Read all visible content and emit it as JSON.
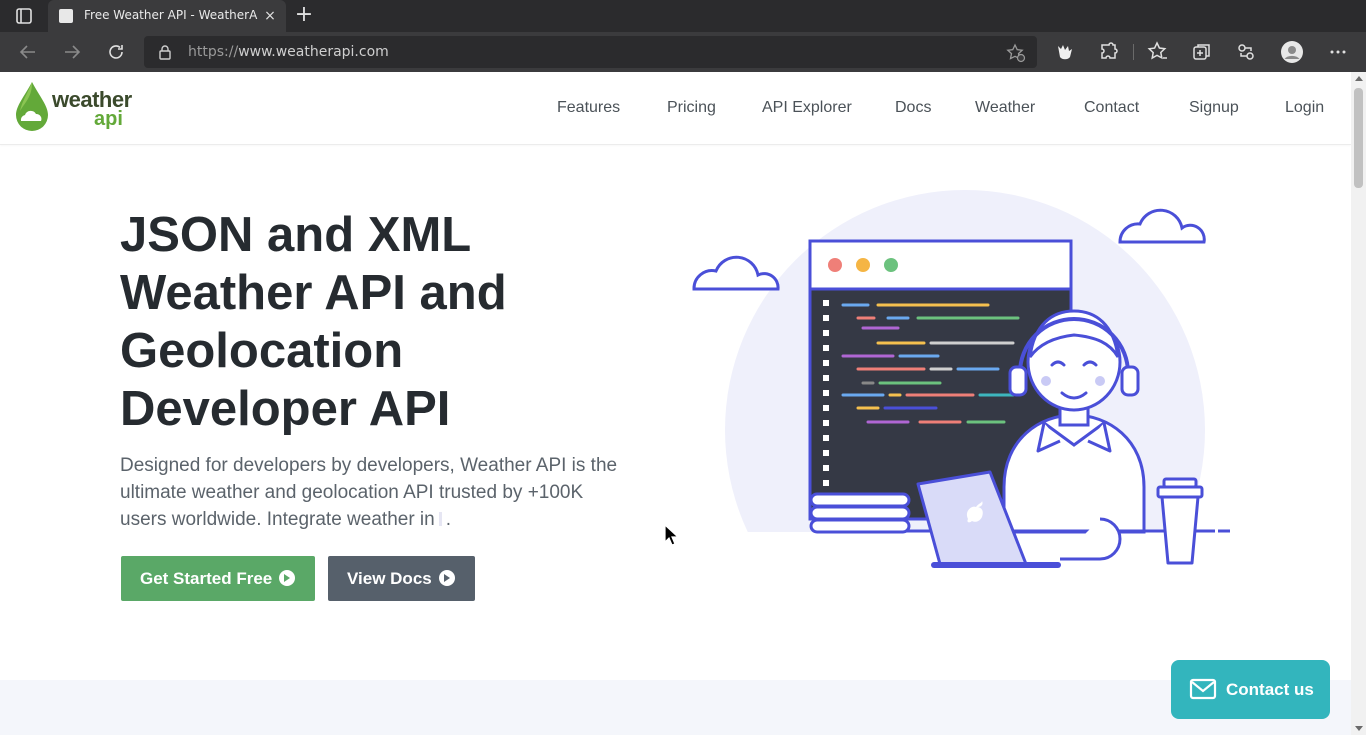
{
  "browser": {
    "tab": {
      "title": "Free Weather API - WeatherAPI",
      "close": "×"
    },
    "new_tab": "+",
    "address": {
      "scheme": "https://",
      "host": "www.weatherapi.com"
    }
  },
  "site": {
    "logo": {
      "word1": "weather",
      "word2": "api"
    },
    "nav": [
      "Features",
      "Pricing",
      "API Explorer",
      "Docs",
      "Weather",
      "Contact",
      "Signup",
      "Login"
    ]
  },
  "hero": {
    "title_lines": [
      "JSON and XML",
      "Weather API and",
      "Geolocation",
      "Developer API"
    ],
    "subtitle_lines": [
      "Designed for developers by developers, Weather API is the",
      "ultimate weather and geolocation API trusted by +100K",
      "users worldwide. Integrate weather in"
    ],
    "subtitle_end": ".",
    "cta_primary": "Get Started Free",
    "cta_secondary": "View Docs"
  },
  "contact_widget": {
    "label": "Contact us"
  },
  "colors": {
    "primary_green": "#5aa867",
    "secondary_grey": "#56606b",
    "contact_teal": "#33b5bd",
    "illustration_blue": "#4a4fd8"
  },
  "icons": [
    "tab-actions-icon",
    "back-icon",
    "forward-icon",
    "refresh-icon",
    "lock-icon",
    "favorite-add-icon",
    "extension-bear-icon",
    "extensions-icon",
    "favorites-icon",
    "collections-icon",
    "share-icon",
    "profile-icon",
    "more-icon",
    "arrow-circle-icon",
    "mail-icon"
  ]
}
